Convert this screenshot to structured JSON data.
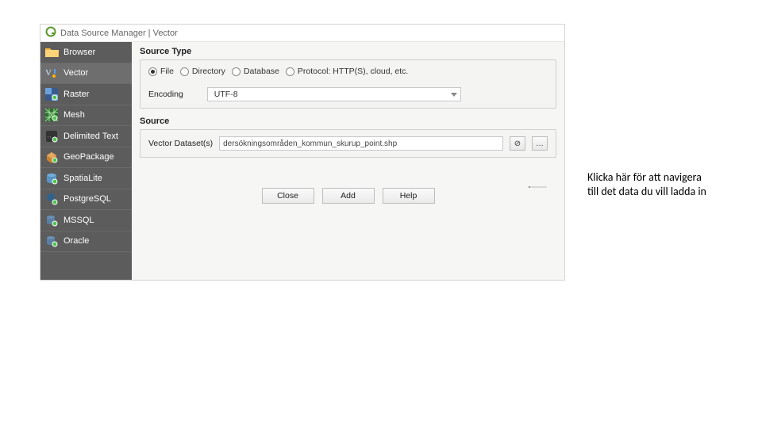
{
  "window": {
    "title": "Data Source Manager | Vector"
  },
  "sidebar": {
    "items": [
      {
        "label": "Browser"
      },
      {
        "label": "Vector"
      },
      {
        "label": "Raster"
      },
      {
        "label": "Mesh"
      },
      {
        "label": "Delimited Text"
      },
      {
        "label": "GeoPackage"
      },
      {
        "label": "SpatiaLite"
      },
      {
        "label": "PostgreSQL"
      },
      {
        "label": "MSSQL"
      },
      {
        "label": "Oracle"
      }
    ]
  },
  "source_type": {
    "title": "Source Type",
    "opts": {
      "file": "File",
      "directory": "Directory",
      "database": "Database",
      "protocol": "Protocol: HTTP(S), cloud, etc."
    },
    "encoding_label": "Encoding",
    "encoding_value": "UTF-8"
  },
  "source": {
    "title": "Source",
    "dataset_label": "Vector Dataset(s)",
    "dataset_value": "dersökningsområden_kommun_skurup_point.shp",
    "clear": "⊘",
    "browse": "…"
  },
  "buttons": {
    "close": "Close",
    "add": "Add",
    "help": "Help"
  },
  "annotation": {
    "line1": "Klicka här för att navigera",
    "line2": "till det data du vill ladda in"
  }
}
